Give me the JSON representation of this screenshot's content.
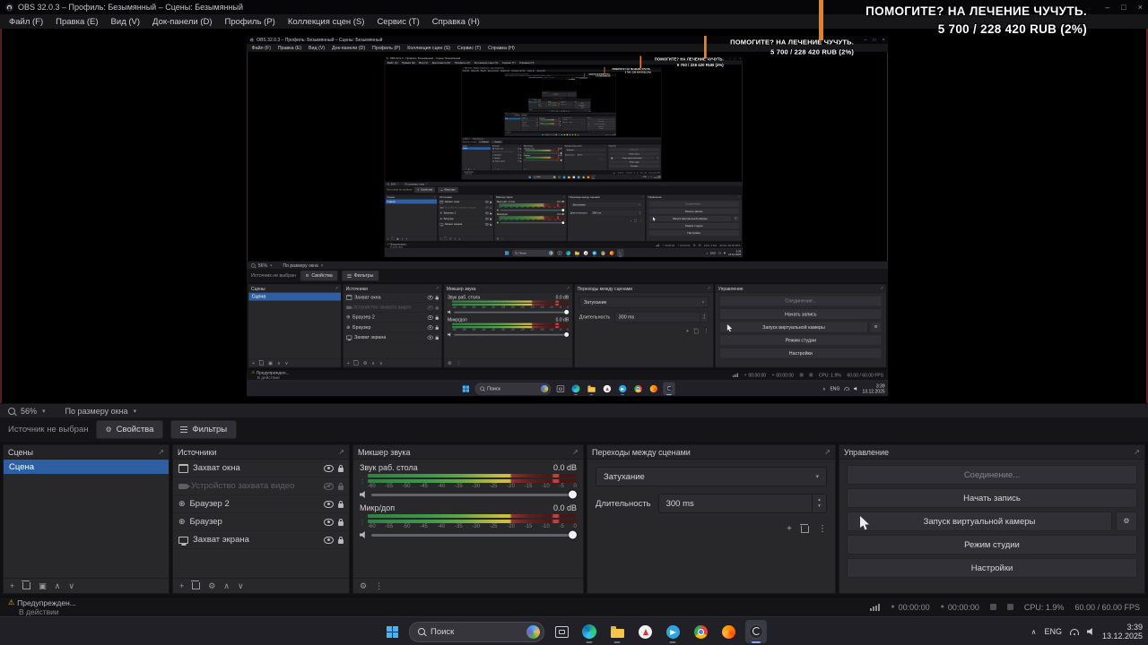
{
  "titlebar": {
    "title": "OBS 32.0.3 – Профиль: Безымянный – Сцены: Безымянный"
  },
  "menu": {
    "items": [
      "Файл (F)",
      "Правка (E)",
      "Вид (V)",
      "Док-панели (D)",
      "Профиль (P)",
      "Коллекция сцен (S)",
      "Сервис (T)",
      "Справка (H)"
    ]
  },
  "overlay": {
    "line1": "ПОМОГИТЕ? НА ЛЕЧЕНИЕ ЧУЧУТЬ.",
    "line2": "5 700 / 228 420 RUB (2%)",
    "accent_color": "#ee7e22"
  },
  "preview_toolbar": {
    "zoom": "56%",
    "fit_mode": "По размеру окна"
  },
  "source_toolbar": {
    "status": "Источник не выбран",
    "properties": "Свойства",
    "filters": "Фильтры"
  },
  "docks": {
    "scenes": {
      "title": "Сцены",
      "items": [
        {
          "label": "Сцена",
          "selected": true
        }
      ]
    },
    "sources": {
      "title": "Источники",
      "items": [
        {
          "label": "Захват окна",
          "icon": "window-capture-icon",
          "visible": true,
          "locked": true
        },
        {
          "label": "Устройство захвата видео",
          "icon": "video-capture-device-icon",
          "visible": false,
          "locked": true
        },
        {
          "label": "Браузер 2",
          "icon": "browser-icon",
          "visible": true,
          "locked": true
        },
        {
          "label": "Браузер",
          "icon": "browser-icon",
          "visible": true,
          "locked": true
        },
        {
          "label": "Захват экрана",
          "icon": "display-capture-icon",
          "visible": true,
          "locked": true
        }
      ]
    },
    "mixer": {
      "title": "Микшер звука",
      "channels": [
        {
          "label": "Звук раб. стола",
          "level": "0.0 dB"
        },
        {
          "label": "Микр/доп",
          "level": "0.0 dB"
        }
      ],
      "scale": [
        "-60",
        "-55",
        "-50",
        "-45",
        "-40",
        "-35",
        "-30",
        "-25",
        "-20",
        "-15",
        "-10",
        "-5",
        "0"
      ]
    },
    "transitions": {
      "title": "Переходы между сценами",
      "transition": "Затухание",
      "duration_label": "Длительность",
      "duration_value": "300 ms"
    },
    "controls": {
      "title": "Управление",
      "stream_button": "Соединение...",
      "record_button": "Начать запись",
      "vcam_button": "Запуск виртуальной камеры",
      "studio_button": "Режим студии",
      "settings_button": "Настройки"
    }
  },
  "statusbar": {
    "warning_title": "Предупрежден...",
    "warning_sub": "В действии",
    "rec_timer": "00:00:00",
    "stream_timer": "00:00:00",
    "cpu": "CPU: 1.9%",
    "fps": "60.00 / 60.00 FPS"
  },
  "taskbar": {
    "search_placeholder": "Поиск",
    "apps": [
      "task-view",
      "edge",
      "explorer",
      "yandex-browser",
      "telegram",
      "chrome",
      "firefox",
      "obs-studio"
    ],
    "tray_lang": "ENG",
    "tray_time": "3:39",
    "tray_date": "13.12.2025"
  },
  "icons": {
    "caret_down": "▾",
    "caret_up": "▴",
    "chevron_up": "∧",
    "chevron_down": "∨",
    "plus": "+",
    "kebab": "⋮",
    "gear": "⚙",
    "duplicate": "▣",
    "globe": "⊕",
    "popout": "↗",
    "warning": "⚠",
    "minimize": "–",
    "maximize": "□",
    "close": "×",
    "record_dot": "●",
    "drag_handle": "⋮"
  }
}
